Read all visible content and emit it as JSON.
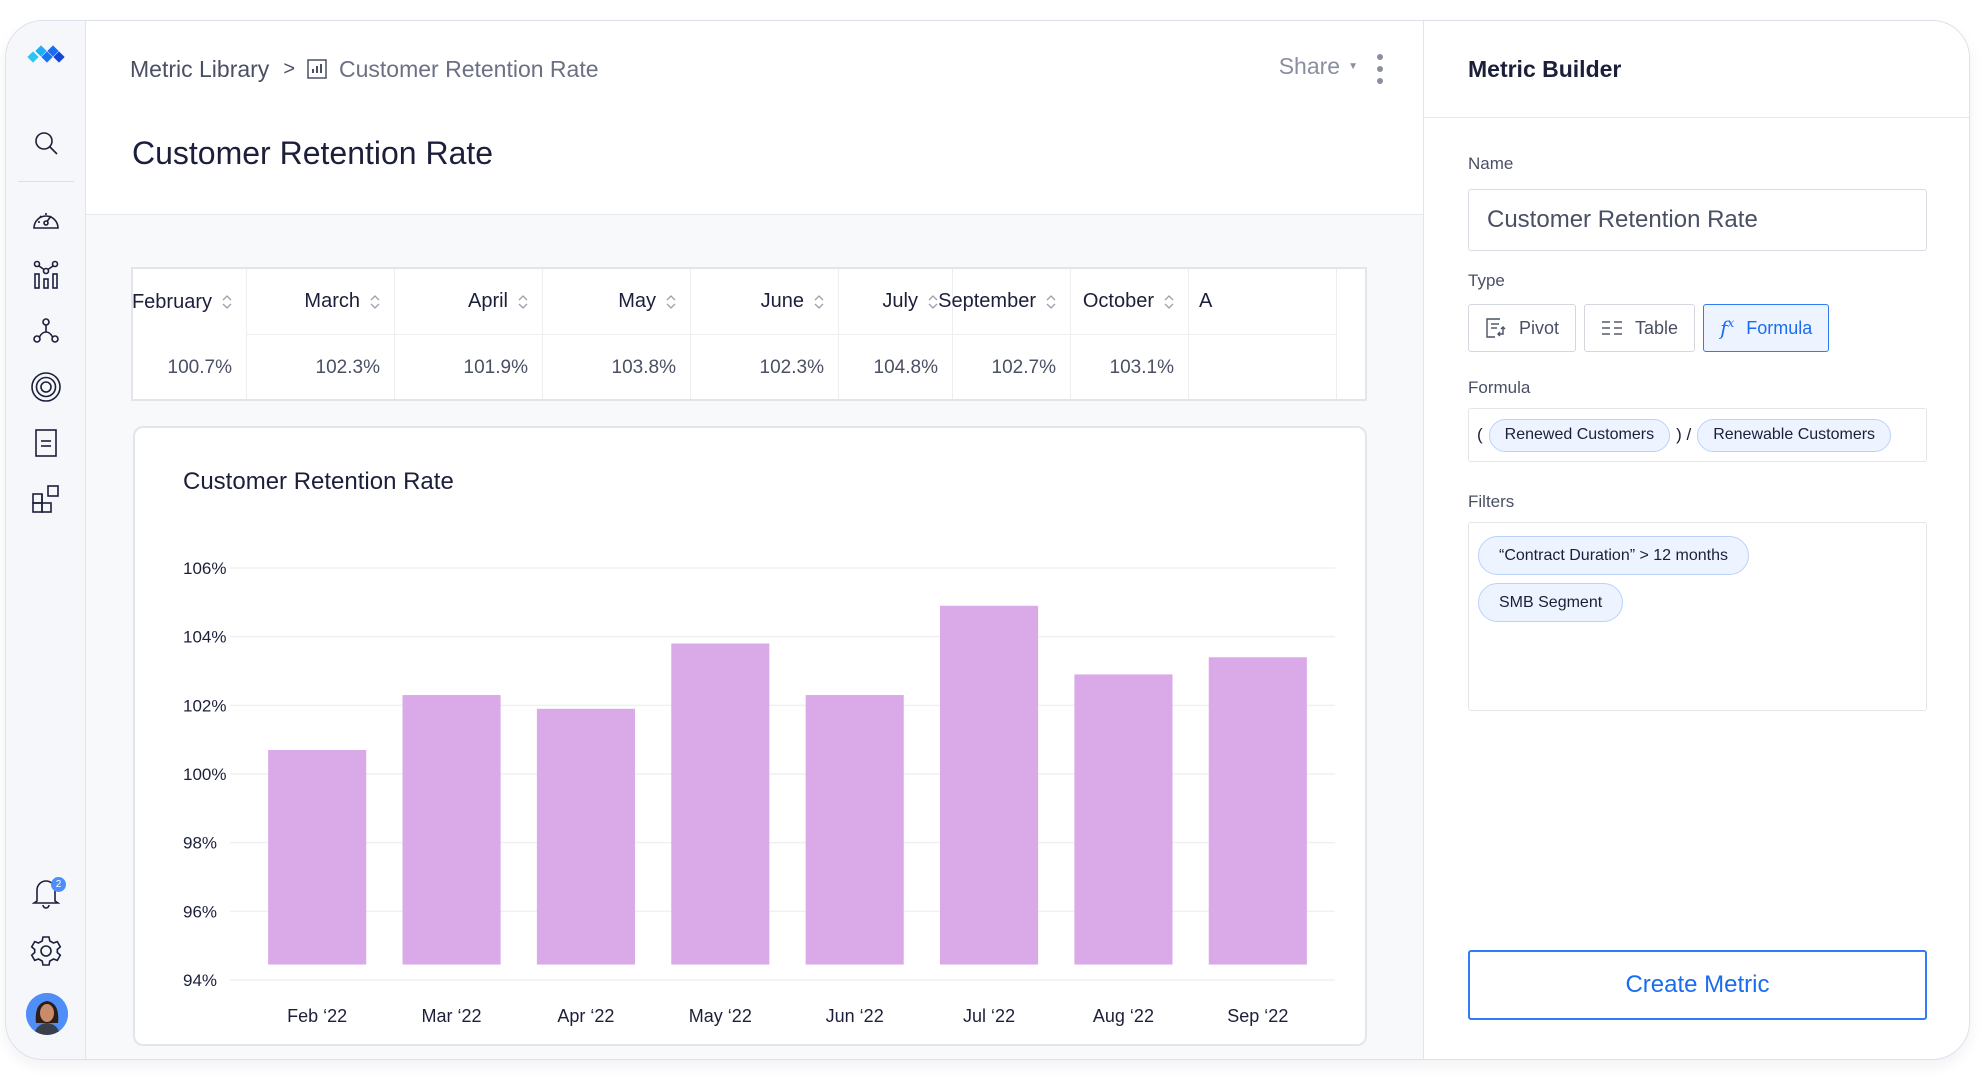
{
  "sidebar": {
    "logo": "app-logo",
    "items": [
      {
        "icon": "search-icon",
        "label": "Search"
      },
      {
        "icon": "dashboard-gauge-icon",
        "label": "Dashboards"
      },
      {
        "icon": "metrics-chart-icon",
        "label": "Metrics"
      },
      {
        "icon": "network-nodes-icon",
        "label": "Connections"
      },
      {
        "icon": "target-icon",
        "label": "Goals"
      },
      {
        "icon": "document-icon",
        "label": "Reports"
      },
      {
        "icon": "apps-grid-icon",
        "label": "Apps"
      }
    ],
    "notifications": {
      "icon": "bell-icon",
      "badge_count": "2"
    },
    "settings": {
      "icon": "gear-icon"
    },
    "avatar": {
      "icon": "user-avatar"
    }
  },
  "header": {
    "breadcrumb": {
      "parent": "Metric Library",
      "separator": ">",
      "current_icon": "bar-chart-icon",
      "current": "Customer Retention Rate"
    },
    "share_label": "Share",
    "more_icon": "kebab-menu-icon",
    "title": "Customer Retention Rate"
  },
  "table": {
    "columns": [
      {
        "header": "February",
        "value": "100.7%"
      },
      {
        "header": "March",
        "value": "102.3%"
      },
      {
        "header": "April",
        "value": "101.9%"
      },
      {
        "header": "May",
        "value": "103.8%"
      },
      {
        "header": "June",
        "value": "102.3%"
      },
      {
        "header": "July",
        "value": "104.8%"
      },
      {
        "header": "September",
        "value": "102.7%"
      },
      {
        "header": "October",
        "value": "103.1%"
      },
      {
        "header": "A",
        "value": ""
      }
    ]
  },
  "chart_data": {
    "type": "bar",
    "title": "Customer Retention Rate",
    "categories": [
      "Feb ‘22",
      "Mar ‘22",
      "Apr ‘22",
      "May ‘22",
      "Jun ‘22",
      "Jul ‘22",
      "Aug ‘22",
      "Sep ‘22"
    ],
    "values": [
      100.7,
      102.3,
      101.9,
      103.8,
      102.3,
      104.9,
      102.9,
      103.4
    ],
    "unit": "%",
    "xlabel": "",
    "ylabel": "",
    "ylim": [
      94,
      106
    ],
    "yticks": [
      94,
      96,
      98,
      100,
      102,
      104,
      106
    ],
    "ytick_labels": [
      "94%",
      "96%",
      "98%",
      "100%",
      "102%",
      "104%",
      "106%"
    ],
    "grid": true,
    "legend": "none",
    "bar_color": "#d9a9e8"
  },
  "panel": {
    "title": "Metric Builder",
    "name_label": "Name",
    "name_value": "Customer Retention Rate",
    "type_label": "Type",
    "types": [
      {
        "label": "Pivot",
        "icon": "pivot-icon",
        "active": false
      },
      {
        "label": "Table",
        "icon": "table-icon",
        "active": false
      },
      {
        "label": "Formula",
        "icon": "function-fx-icon",
        "active": true
      }
    ],
    "formula_label": "Formula",
    "formula": {
      "open_paren": "(",
      "term1": "Renewed Customers",
      "operator": ") /",
      "term2": "Renewable Customers"
    },
    "filters_label": "Filters",
    "filters": [
      "“Contract Duration” > 12 months",
      "SMB Segment"
    ],
    "create_button": "Create Metric"
  },
  "colors": {
    "accent": "#2f7cf6",
    "bar": "#d9a9e8",
    "text_primary": "#1c1f3a",
    "text_secondary": "#4a5064"
  }
}
